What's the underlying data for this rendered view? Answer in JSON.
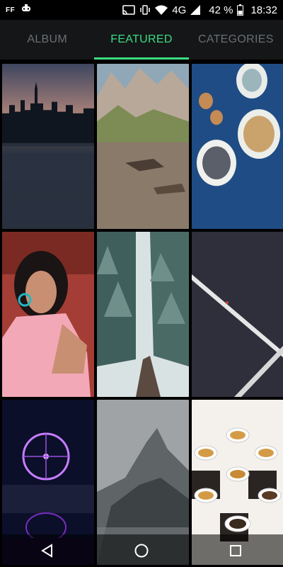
{
  "status_bar": {
    "left_badge": "FF",
    "network": "4G",
    "battery_percent": "42 %",
    "time": "18:32",
    "icons": [
      "notification-ff-icon",
      "game-controller-icon",
      "cast-icon",
      "vibrate-icon",
      "wifi-icon",
      "signal-icon",
      "battery-icon"
    ]
  },
  "tabs": [
    {
      "label": "ALBUM",
      "active": false
    },
    {
      "label": "FEATURED",
      "active": true
    },
    {
      "label": "CATEGORIES",
      "active": false
    }
  ],
  "colors": {
    "accent": "#3ddc84",
    "tab_inactive": "#6b6f73",
    "tab_bg": "#141618"
  },
  "wallpapers": [
    {
      "subject": "city skyline at dusk"
    },
    {
      "subject": "mountain lake reflection"
    },
    {
      "subject": "bowls of food on blue table"
    },
    {
      "subject": "woman in pink shirt"
    },
    {
      "subject": "snowy forest road"
    },
    {
      "subject": "minimal diagonal lines"
    },
    {
      "subject": "ferris wheel at night"
    },
    {
      "subject": "foggy mountain coast"
    },
    {
      "subject": "coffee cups on board"
    }
  ],
  "nav": [
    "back-icon",
    "home-icon",
    "recents-icon"
  ]
}
